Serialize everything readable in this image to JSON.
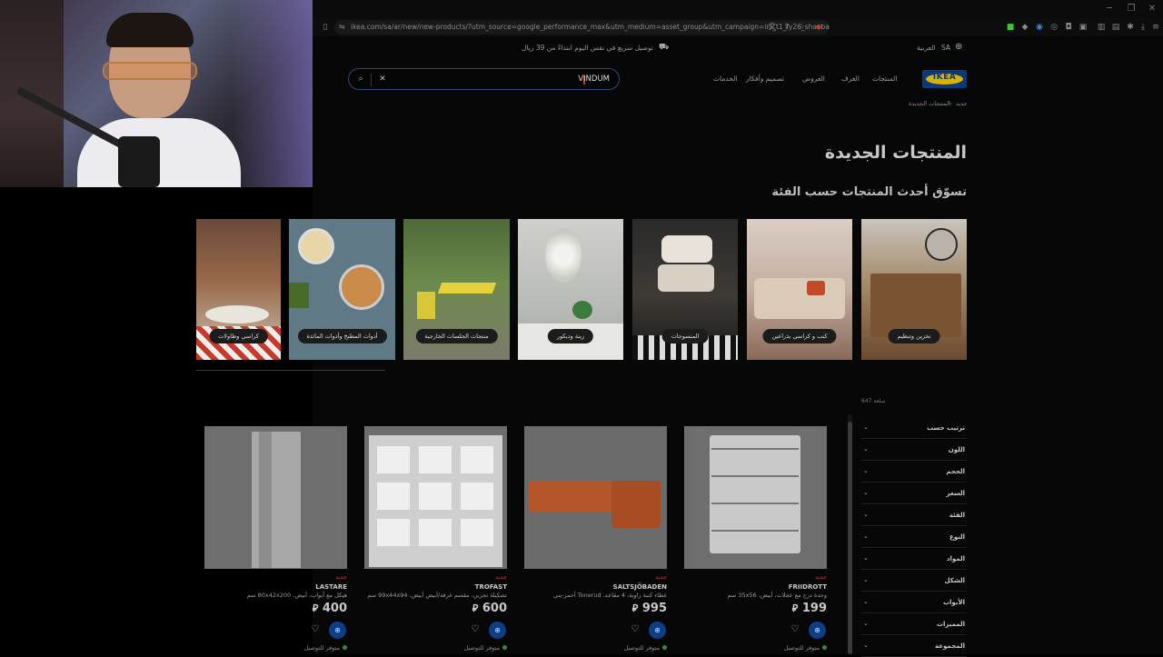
{
  "browser": {
    "url": "ikea.com/sa/ar/new/new-products/?utm_source=google_performance_max&utm_medium=asset_group&utm_campaign=ini_t1_fy26_shaaban_..."
  },
  "announcement": {
    "delivery_text": "توصيل سريع في نفس اليوم ابتداءً من 39 ريال",
    "country": "SA",
    "language": "العربية"
  },
  "header": {
    "logo": "IKEA",
    "nav": [
      "المنتجات",
      "الغرف",
      "العروض",
      "تصميم وأفكار",
      "الخدمات"
    ],
    "search": {
      "value": "VINDUM"
    }
  },
  "breadcrumb": {
    "items": [
      "جديد",
      "المنتجات الجديدة"
    ]
  },
  "page": {
    "title": "المنتجات الجديدة",
    "section_title": "تسوّق أحدث المنتجات حسب الفئة"
  },
  "categories": [
    {
      "label": "تخزين وتنظيم"
    },
    {
      "label": "كنب و كراسي بذراعين"
    },
    {
      "label": "المنسوجات"
    },
    {
      "label": "زينة وديكور"
    },
    {
      "label": "منتجات الجلسات الخارجية"
    },
    {
      "label": "أدوات المطبخ وأدوات المائدة"
    },
    {
      "label": "كراسي وطاولات"
    }
  ],
  "results": {
    "count": "647 سلعة"
  },
  "filters": [
    "ترتيب حسب",
    "اللون",
    "الحجم",
    "السعر",
    "الفئة",
    "النوع",
    "المواد",
    "الشكل",
    "الأبواب",
    "المميزات",
    "المجموعة"
  ],
  "products": [
    {
      "badge": "جديد",
      "name": "FRIIDROTT",
      "desc": "وحدة درج مع عجلات، أبيض، 35x56 سم",
      "price": "199",
      "currency": "⃁",
      "availability": "متوفر للتوصيل"
    },
    {
      "badge": "جديد",
      "name": "SALTSJÖBADEN",
      "desc": "غطاء كنبة زاوية، 4 مقاعد، Tonerud أحمر-بني",
      "price": "995",
      "currency": "⃁",
      "availability": "متوفر للتوصيل"
    },
    {
      "badge": "جديد",
      "name": "TROFAST",
      "desc": "تشكيلة تخزين، مقسم غرفة/أبيض أبيض، 99x44x94 سم",
      "price": "600",
      "currency": "⃁",
      "availability": "متوفر للتوصيل"
    },
    {
      "badge": "جديد",
      "name": "LASTARE",
      "desc": "هيكل مع أبواب، أبيض، 80x42x200 سم",
      "price": "400",
      "currency": "⃁",
      "availability": "متوفر للتوصيل"
    }
  ]
}
